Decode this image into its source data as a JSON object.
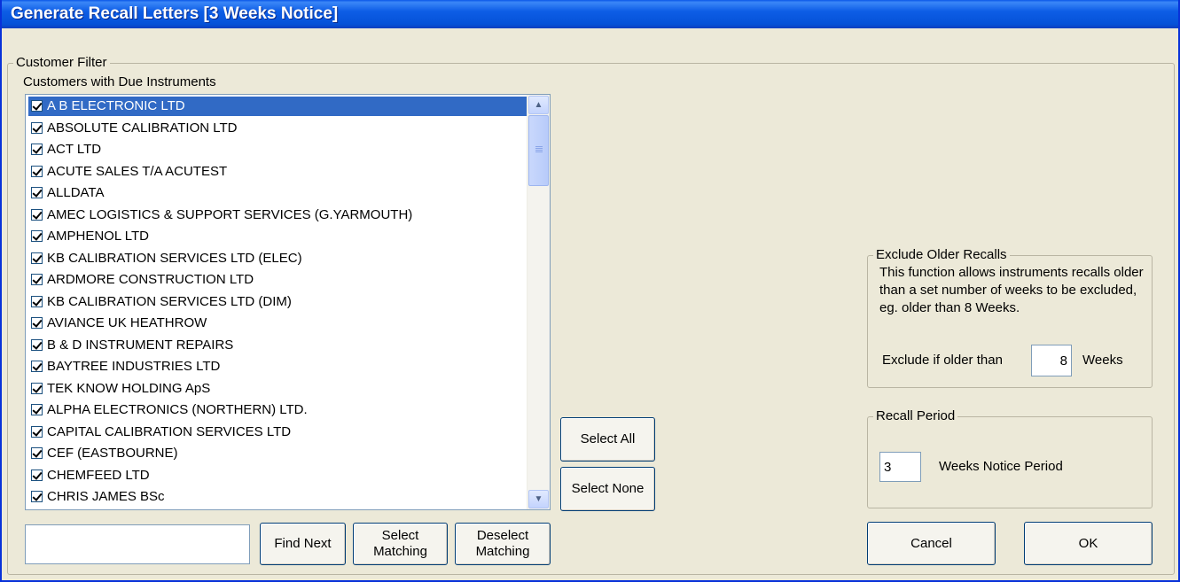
{
  "window": {
    "title": "Generate Recall Letters [3 Weeks Notice]"
  },
  "customer_filter": {
    "legend": "Customer Filter",
    "list_label": "Customers with Due Instruments",
    "customers": [
      {
        "name": "A B ELECTRONIC LTD",
        "checked": true,
        "selected": true
      },
      {
        "name": "ABSOLUTE CALIBRATION LTD",
        "checked": true
      },
      {
        "name": "ACT LTD",
        "checked": true
      },
      {
        "name": "ACUTE SALES T/A ACUTEST",
        "checked": true
      },
      {
        "name": "ALLDATA",
        "checked": true
      },
      {
        "name": "AMEC LOGISTICS & SUPPORT SERVICES  (G.YARMOUTH)",
        "checked": true
      },
      {
        "name": "AMPHENOL LTD",
        "checked": true
      },
      {
        "name": "KB CALIBRATION SERVICES LTD (ELEC)",
        "checked": true
      },
      {
        "name": "ARDMORE CONSTRUCTION LTD",
        "checked": true
      },
      {
        "name": "KB CALIBRATION SERVICES LTD (DIM)",
        "checked": true
      },
      {
        "name": "AVIANCE UK HEATHROW",
        "checked": true
      },
      {
        "name": "B & D INSTRUMENT REPAIRS",
        "checked": true
      },
      {
        "name": "BAYTREE INDUSTRIES LTD",
        "checked": true
      },
      {
        "name": "TEK KNOW HOLDING ApS",
        "checked": true
      },
      {
        "name": "ALPHA ELECTRONICS (NORTHERN) LTD.",
        "checked": true
      },
      {
        "name": "CAPITAL CALIBRATION SERVICES LTD",
        "checked": true
      },
      {
        "name": "CEF (EASTBOURNE)",
        "checked": true
      },
      {
        "name": "CHEMFEED LTD",
        "checked": true
      },
      {
        "name": "CHRIS JAMES BSc",
        "checked": true
      }
    ],
    "search": {
      "value": "",
      "placeholder": ""
    },
    "find_next_label": "Find Next",
    "select_matching_label": "Select Matching",
    "deselect_matching_label": "Deselect Matching",
    "select_all_label": "Select All",
    "select_none_label": "Select None"
  },
  "exclude_older": {
    "legend": "Exclude Older Recalls",
    "description": "This function allows instruments recalls older than a set number of weeks to be excluded, eg. older than 8 Weeks.",
    "prefix_label": "Exclude if older than",
    "weeks_value": "8",
    "suffix_label": "Weeks"
  },
  "recall_period": {
    "legend": "Recall Period",
    "weeks_value": "3",
    "suffix_label": "Weeks Notice Period"
  },
  "actions": {
    "cancel_label": "Cancel",
    "ok_label": "OK"
  }
}
